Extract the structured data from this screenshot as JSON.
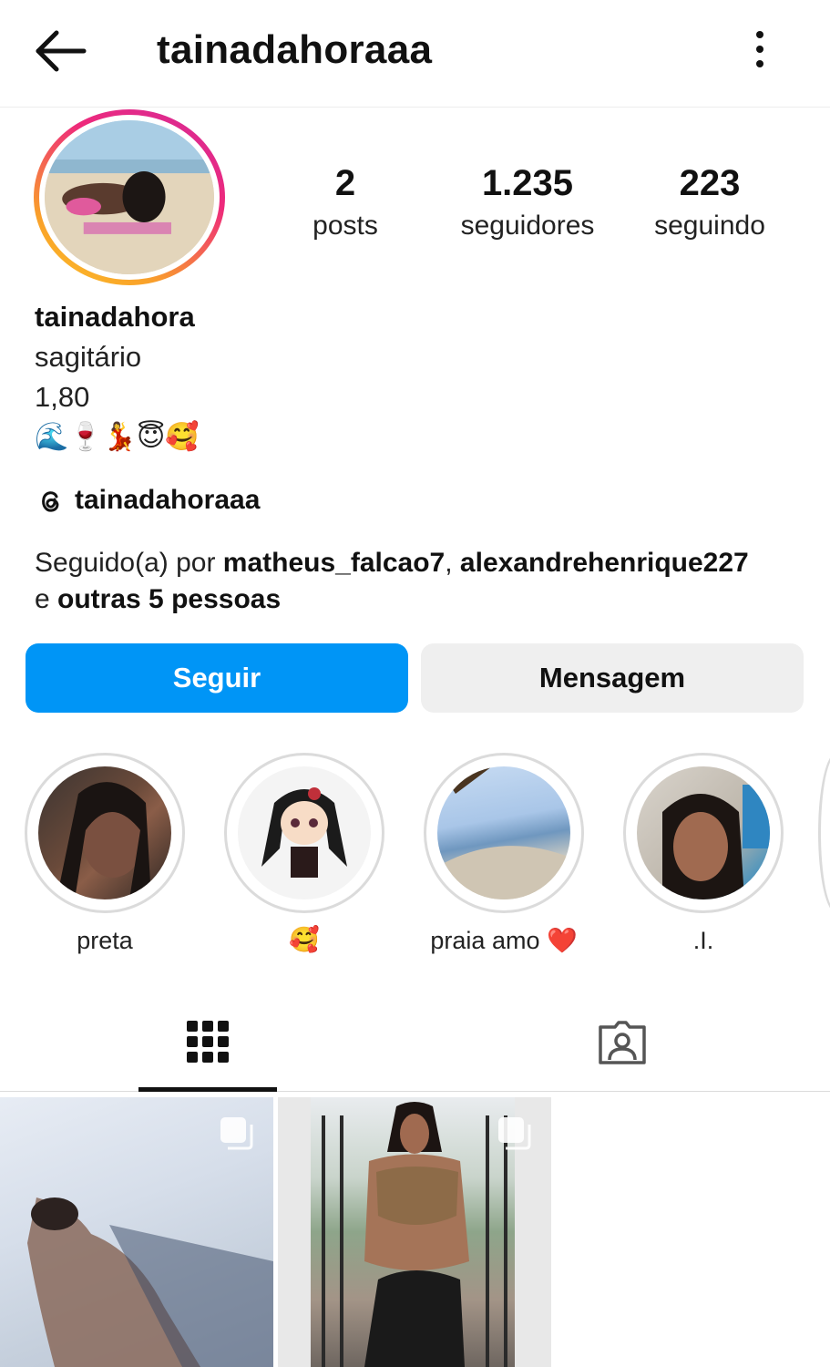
{
  "header": {
    "username": "tainadahoraaa",
    "back_icon": "arrow-left-icon",
    "more_icon": "vertical-dots-icon"
  },
  "stats": {
    "posts": {
      "value": "2",
      "label": "posts"
    },
    "followers": {
      "value": "1.235",
      "label": "seguidores"
    },
    "following": {
      "value": "223",
      "label": "seguindo"
    }
  },
  "bio": {
    "name": "tainadahora",
    "line1": "sagitário",
    "line2": "1,80",
    "emojis": "🌊🍷💃😇🥰"
  },
  "threads": {
    "icon": "threads-icon",
    "handle": "tainadahoraaa"
  },
  "followed_by": {
    "prefix": "Seguido(a) por ",
    "user1": "matheus_falcao7",
    "separator": ", ",
    "user2": "alexandrehenrique227",
    "connector": "e ",
    "others": "outras 5 pessoas"
  },
  "buttons": {
    "follow": "Seguir",
    "message": "Mensagem"
  },
  "highlights": [
    {
      "label": "preta"
    },
    {
      "label": "🥰"
    },
    {
      "label": "praia amo ❤️"
    },
    {
      "label": ".I."
    }
  ],
  "tabs": {
    "grid_icon": "grid-icon",
    "tagged_icon": "tagged-person-icon",
    "active": "grid"
  },
  "posts": [
    {
      "type": "carousel",
      "icon": "multiple-posts-icon"
    },
    {
      "type": "carousel",
      "icon": "multiple-posts-icon"
    }
  ],
  "colors": {
    "primary_button": "#0095f6",
    "secondary_button": "#efefef",
    "story_ring_start": "#fdc327",
    "story_ring_end": "#d42b9a"
  }
}
